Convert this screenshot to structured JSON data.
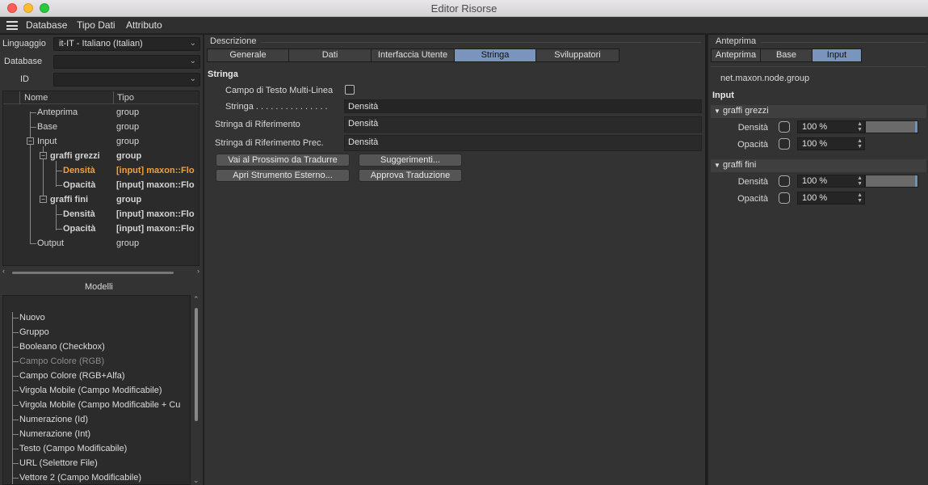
{
  "window": {
    "title": "Editor Risorse"
  },
  "menubar": {
    "items": [
      "Database",
      "Tipo Dati",
      "Attributo"
    ]
  },
  "left": {
    "language_label": "Linguaggio",
    "language_value": "it-IT - Italiano (Italian)",
    "database_label": "Database",
    "database_value": "",
    "id_label": "ID",
    "id_value": "",
    "tree": {
      "col_name": "Nome",
      "col_type": "Tipo",
      "rows": [
        {
          "name": "Anteprima",
          "type": "group"
        },
        {
          "name": "Base",
          "type": "group"
        },
        {
          "name": "Input",
          "type": "group"
        },
        {
          "name": "graffi grezzi",
          "type": "group"
        },
        {
          "name": "Densità",
          "type": "[input] maxon::Flo"
        },
        {
          "name": "Opacità",
          "type": "[input] maxon::Flo"
        },
        {
          "name": "graffi fini",
          "type": "group"
        },
        {
          "name": "Densità",
          "type": "[input] maxon::Flo"
        },
        {
          "name": "Opacità",
          "type": "[input] maxon::Flo"
        },
        {
          "name": "Output",
          "type": "group"
        }
      ]
    },
    "models_title": "Modelli",
    "models": [
      "Nuovo",
      "Gruppo",
      "Booleano (Checkbox)",
      "Campo Colore (RGB)",
      "Campo Colore (RGB+Alfa)",
      "Virgola Mobile (Campo Modificabile)",
      "Virgola Mobile (Campo Modificabile + Cu",
      "Numerazione (Id)",
      "Numerazione (Int)",
      "Testo (Campo Modificabile)",
      "URL (Selettore File)",
      "Vettore 2 (Campo Modificabile)"
    ]
  },
  "center": {
    "group_title": "Descrizione",
    "tabs": [
      "Generale",
      "Dati",
      "Interfaccia Utente",
      "Stringa",
      "Sviluppatori"
    ],
    "active_tab": "Stringa",
    "section_title": "Stringa",
    "multiline_label": "Campo di Testo Multi-Linea",
    "string_label": "Stringa . . . . . . . . . . . . . . .",
    "string_value": "Densità",
    "ref_label": "Stringa di Riferimento",
    "ref_value": "Densità",
    "prev_ref_label": "Stringa di Riferimento Prec.",
    "prev_ref_value": "Densità",
    "buttons": {
      "next": "Vai al Prossimo da Tradurre",
      "suggest": "Suggerimenti...",
      "external": "Apri Strumento Esterno...",
      "approve": "Approva Traduzione"
    }
  },
  "right": {
    "group_title": "Anteprima",
    "tabs": [
      "Anteprima",
      "Base",
      "Input"
    ],
    "active_tab": "Input",
    "node_id": "net.maxon.node.group",
    "input_title": "Input",
    "groups": [
      {
        "title": "graffi grezzi",
        "params": [
          {
            "label": "Densità",
            "value": "100 %",
            "fraction": 1.0
          },
          {
            "label": "Opacità",
            "value": "100 %"
          }
        ]
      },
      {
        "title": "graffi fini",
        "params": [
          {
            "label": "Densità",
            "value": "100 %",
            "fraction": 1.0
          },
          {
            "label": "Opacità",
            "value": "100 %"
          }
        ]
      }
    ]
  }
}
